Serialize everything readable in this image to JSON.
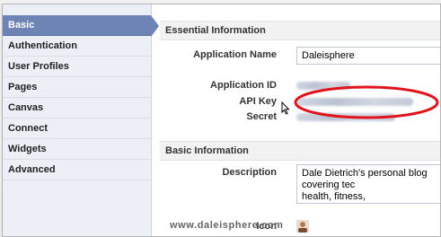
{
  "sidebar": {
    "items": [
      {
        "label": "Basic"
      },
      {
        "label": "Authentication"
      },
      {
        "label": "User Profiles"
      },
      {
        "label": "Pages"
      },
      {
        "label": "Canvas"
      },
      {
        "label": "Connect"
      },
      {
        "label": "Widgets"
      },
      {
        "label": "Advanced"
      }
    ]
  },
  "essential": {
    "header": "Essential Information",
    "application_name_label": "Application Name",
    "application_name_value": "Daleisphere",
    "application_id_label": "Application ID",
    "api_key_label": "API Key",
    "secret_label": "Secret"
  },
  "basic": {
    "header": "Basic Information",
    "description_label": "Description",
    "description_value": "Dale Dietrich's personal blog covering tec\nhealth, fitness, wine/scotch/coffee/movie",
    "icon_label": "Icon"
  },
  "watermark": "www.daleisphere.com",
  "colors": {
    "sidebar_active": "#6d84b4",
    "annotation_red": "#e0141c"
  }
}
